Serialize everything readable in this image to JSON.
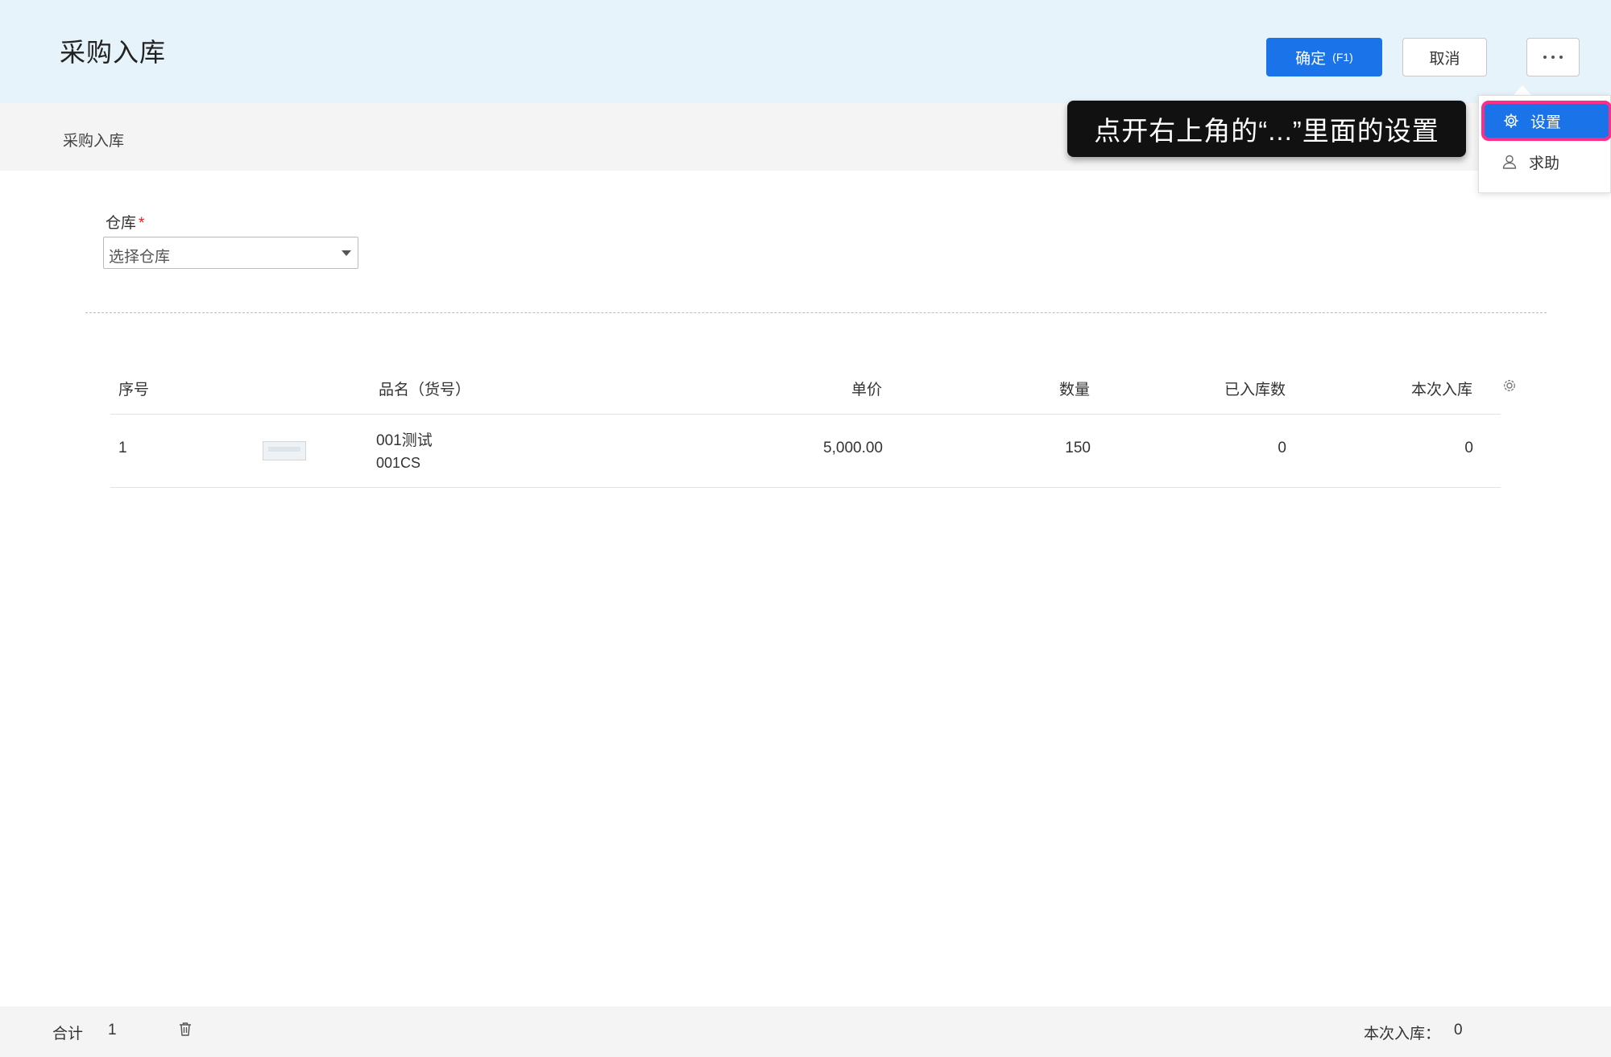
{
  "header": {
    "title": "采购入库",
    "confirm_label": "确定",
    "confirm_hotkey": "(F1)",
    "cancel_label": "取消"
  },
  "breadcrumb": "采购入库",
  "tooltip": "点开右上角的“...”里面的设置",
  "more_menu": {
    "items": [
      {
        "label": "设置",
        "icon": "gear-icon",
        "highlighted": true
      },
      {
        "label": "求助",
        "icon": "user-icon"
      }
    ]
  },
  "warehouse": {
    "label": "仓库",
    "required_mark": "*",
    "placeholder": "选择仓库"
  },
  "table": {
    "columns": [
      "序号",
      "品名（货号）",
      "单价",
      "数量",
      "已入库数",
      "本次入库"
    ],
    "rows": [
      {
        "index": "1",
        "name": "001测试",
        "code": "001CS",
        "price": "5,000.00",
        "qty": "150",
        "received": "0",
        "this_time": "0"
      }
    ]
  },
  "footer": {
    "total_label": "合计",
    "total_count": "1",
    "this_time_label": "本次入库：",
    "this_time_value": "0"
  },
  "colors": {
    "header_bg": "#e6f3fa",
    "primary": "#1a73e8",
    "highlight_border": "#ff2d8a"
  }
}
